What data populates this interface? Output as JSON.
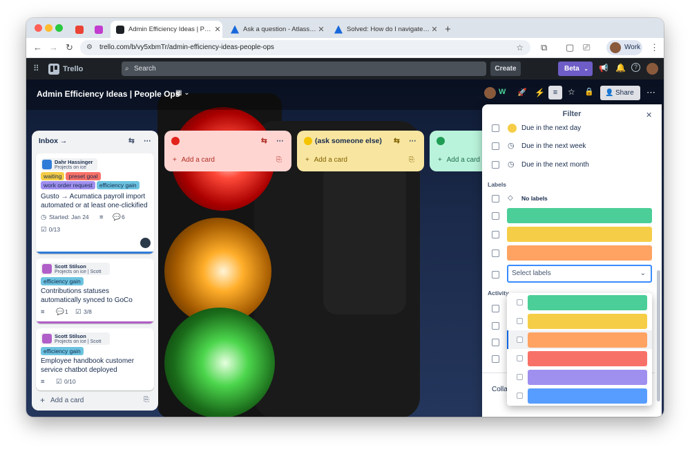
{
  "browser": {
    "tabs": [
      {
        "title": "Admin Efficiency Ideas | People Ops"
      },
      {
        "title": "Ask a question - Atlassian Co..."
      },
      {
        "title": "Solved: How do I navigate pa..."
      }
    ],
    "url": "trello.com/b/vy5xbmTr/admin-efficiency-ideas-people-ops",
    "profile_label": "Work"
  },
  "trello": {
    "app_name": "Trello",
    "search_placeholder": "Search",
    "create_label": "Create",
    "beta_label": "Beta"
  },
  "board": {
    "title": "Admin Efficiency Ideas | People Ops",
    "share_label": "Share"
  },
  "lists": [
    {
      "title": "Inbox →",
      "add_card": "Add a card",
      "cards": [
        {
          "author": "Dahr Hassinger",
          "source": "Projects on ice",
          "labels": [
            {
              "text": "waiting",
              "color": "#f5cd47"
            },
            {
              "text": "preset goal",
              "color": "#f87168"
            },
            {
              "text": "work order request",
              "color": "#9f8fef"
            },
            {
              "text": "efficiency gain",
              "color": "#6cc3e0"
            }
          ],
          "title": "Gusto → Acumatica payroll import automated or at least one-clickified",
          "started": "Started: Jan 24",
          "comments": "6",
          "checklist": "0/13"
        },
        {
          "author": "Scott Stilson",
          "source": "Projects on ice | Scott",
          "labels": [
            {
              "text": "efficiency gain",
              "color": "#6cc3e0"
            }
          ],
          "title": "Contributions statuses automatically synced to GoCo",
          "comments": "1",
          "checklist": "3/8"
        },
        {
          "author": "Scott Stilson",
          "source": "Projects on ice | Scott",
          "labels": [
            {
              "text": "efficiency gain",
              "color": "#6cc3e0"
            }
          ],
          "title": "Employee handbook customer service chatbot deployed",
          "checklist": "0/10"
        }
      ]
    },
    {
      "title": "",
      "add_card": "Add a card",
      "color": "#f87168"
    },
    {
      "title": "(ask someone else)",
      "add_card": "Add a card",
      "color": "#f5cd47"
    },
    {
      "title": "",
      "add_card": "Add a card",
      "color": "#4bce97"
    }
  ],
  "filter": {
    "title": "Filter",
    "due": [
      "Due in the next day",
      "Due in the next week",
      "Due in the next month"
    ],
    "labels_heading": "Labels",
    "no_labels": "No labels",
    "label_colors": [
      "#4bce97",
      "#f5cd47",
      "#fea362"
    ],
    "select_placeholder": "Select labels",
    "activity_heading": "Activity",
    "collapse_label": "Collapse"
  },
  "dropdown": {
    "options": [
      "#4bce97",
      "#f5cd47",
      "#fea362",
      "#f87168",
      "#9f8fef",
      "#579dff"
    ]
  }
}
